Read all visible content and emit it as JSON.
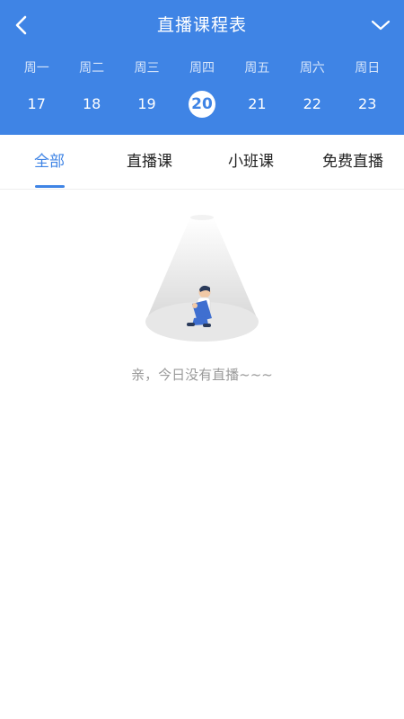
{
  "header": {
    "title": "直播课程表",
    "back_icon": "chevron-left-icon",
    "expand_icon": "chevron-down-icon",
    "background": "#3f84e5"
  },
  "week": {
    "days": [
      "周一",
      "周二",
      "周三",
      "周四",
      "周五",
      "周六",
      "周日"
    ],
    "dates": [
      "17",
      "18",
      "19",
      "20",
      "21",
      "22",
      "23"
    ],
    "selected_date": "20"
  },
  "tabs": {
    "items": [
      "全部",
      "直播课",
      "小班课",
      "免费直播"
    ],
    "active": "全部",
    "accent": "#3f84e5"
  },
  "empty": {
    "illustration": "spotlight-person-sitting-illustration",
    "message": "亲，今日没有直播~~~"
  }
}
